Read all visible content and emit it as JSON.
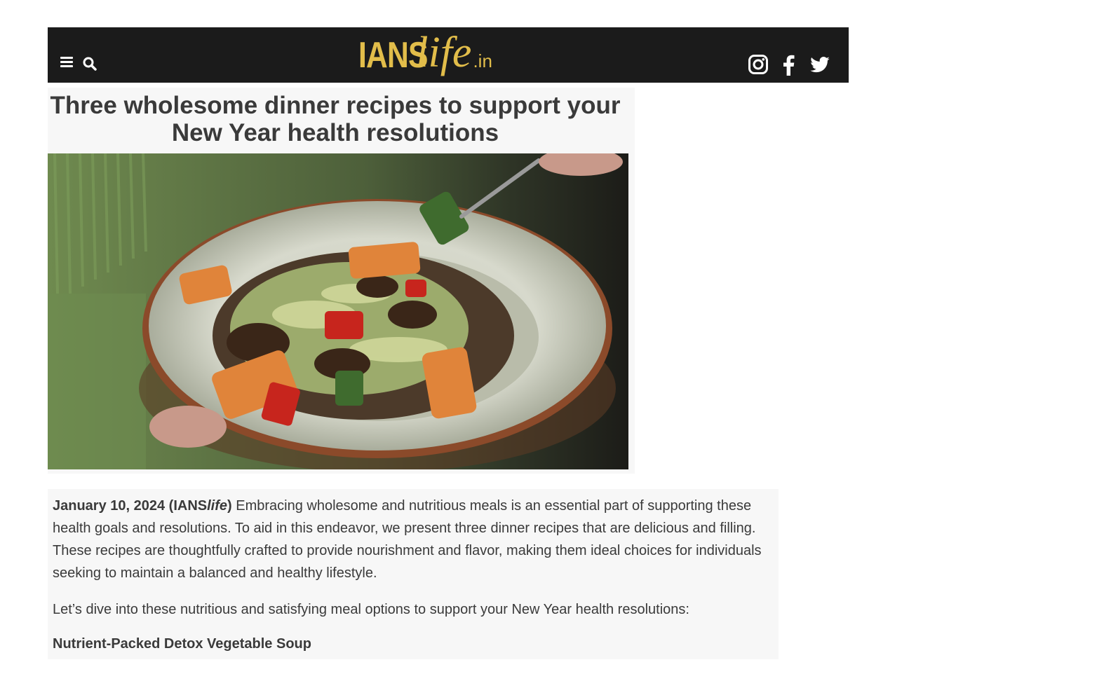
{
  "header": {
    "logo_main": "IANS",
    "logo_script": "life",
    "logo_suffix": ".in",
    "menu_icon": "hamburger-menu-icon",
    "search_icon": "search-icon",
    "social_icons": [
      "instagram-icon",
      "facebook-icon",
      "twitter-icon"
    ],
    "background_color": "#1b1b1b",
    "logo_color": "#e2bd4a"
  },
  "article": {
    "title": "Three wholesome dinner recipes to support your New Year health resolutions",
    "image_description": "salad-bowl-photo",
    "dateline_date": "January 10, 2024 (IANS",
    "dateline_source_italic": "life",
    "dateline_close": ")",
    "intro": " Embracing wholesome and nutritious meals is an essential part of supporting these health goals and resolutions. To aid in this endeavor, we present three dinner recipes that are delicious and filling. These recipes are thoughtfully crafted to provide nourishment and flavor, making them ideal choices for individuals seeking to maintain a balanced and healthy lifestyle.",
    "paragraph_2": "Let’s dive into these nutritious and satisfying meal options to support your New Year health resolutions:",
    "subheading": "Nutrient-Packed Detox Vegetable Soup"
  }
}
